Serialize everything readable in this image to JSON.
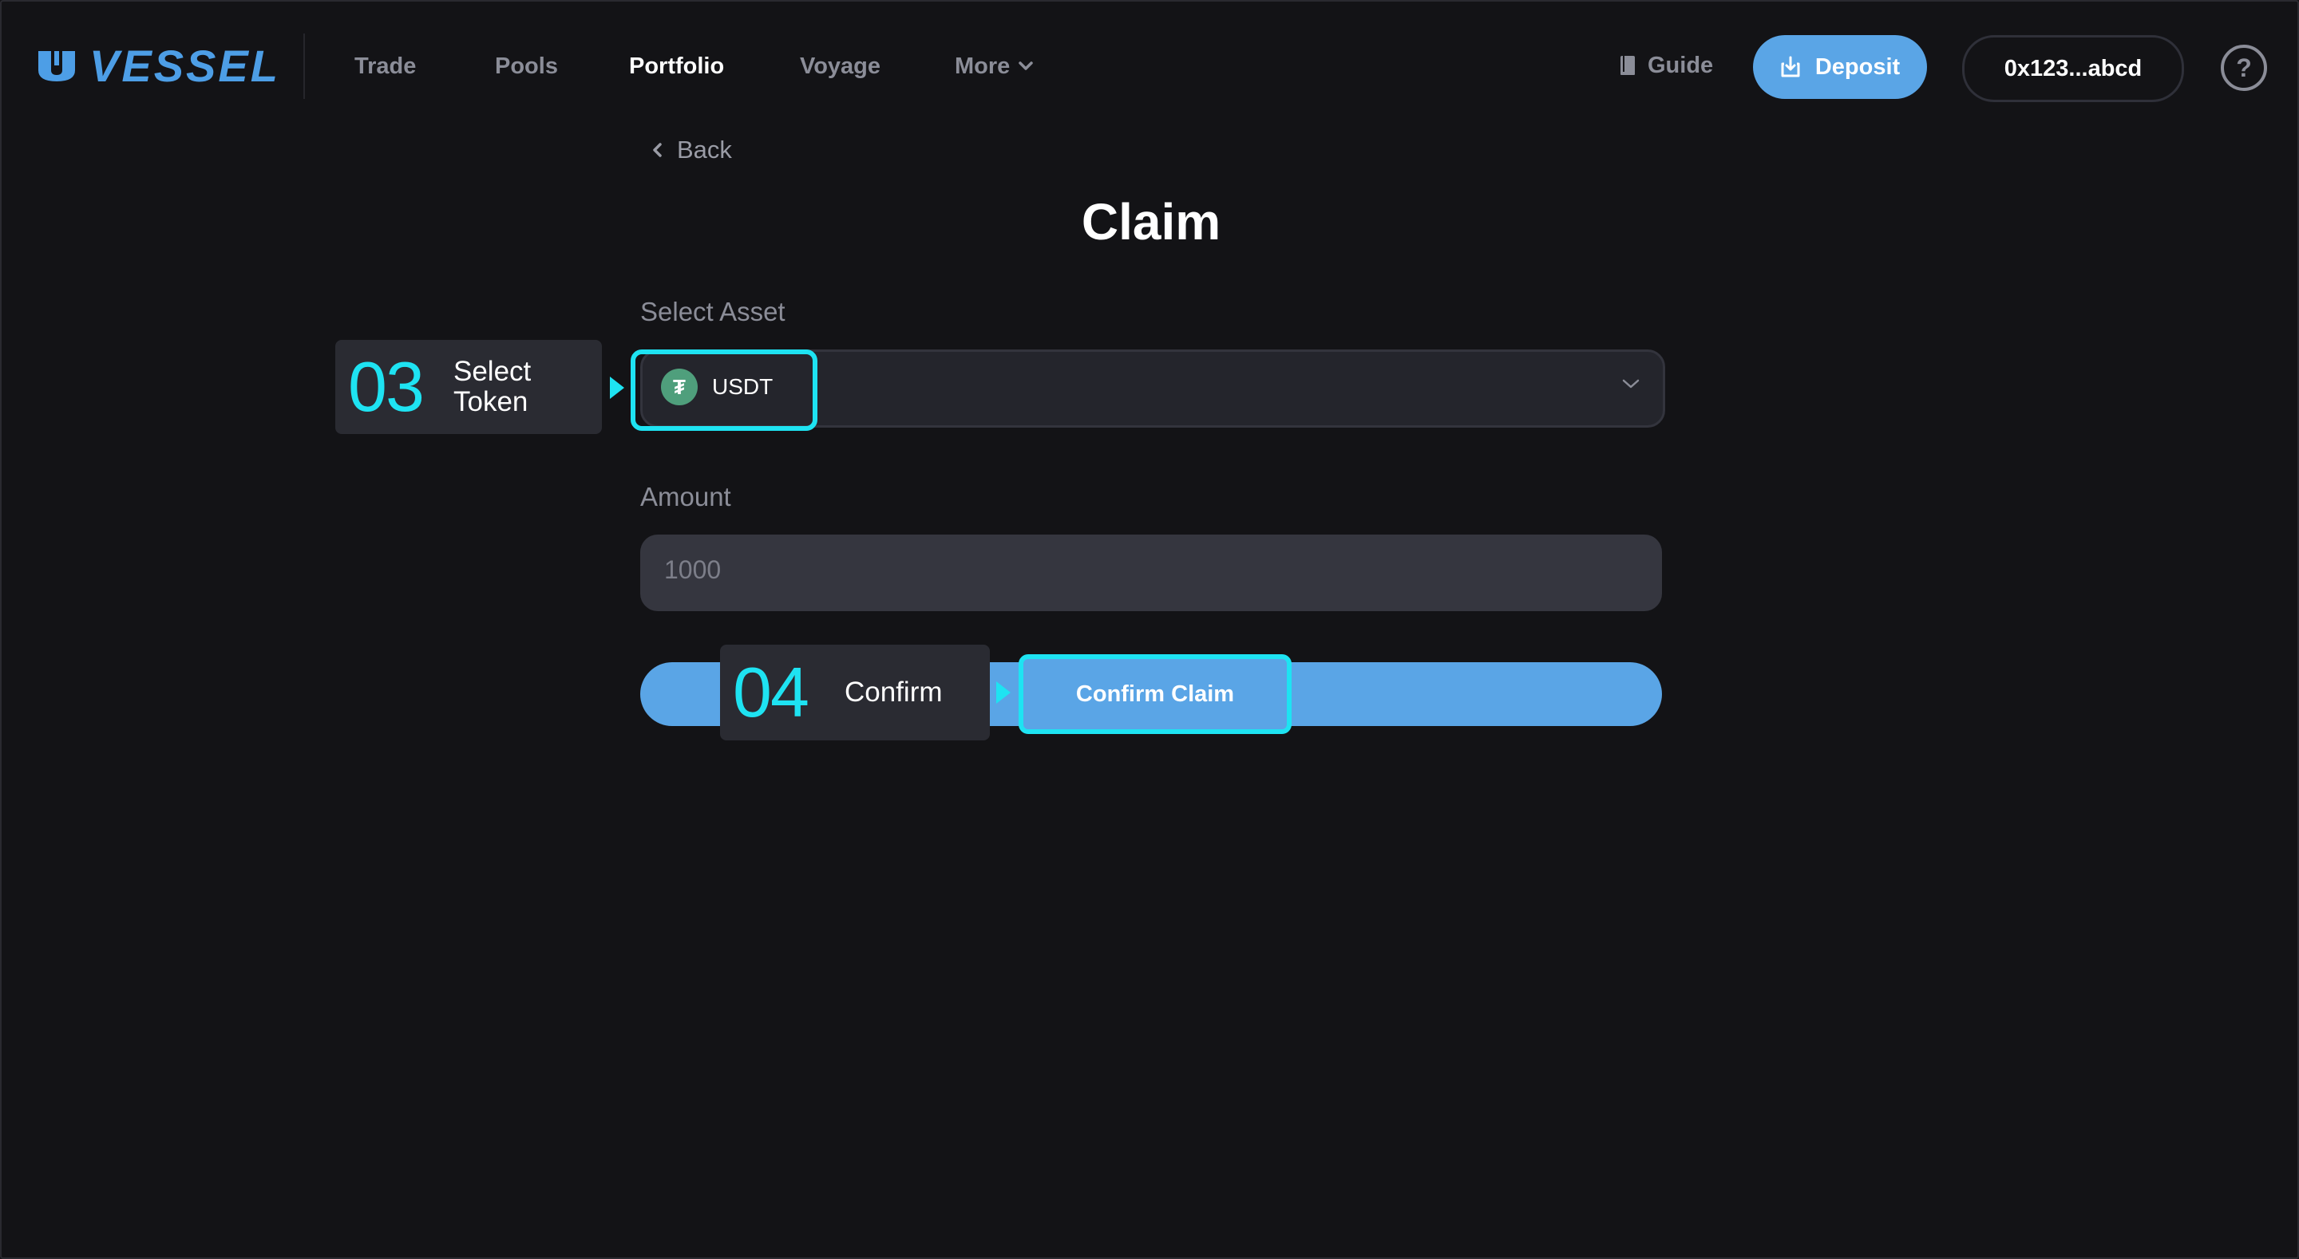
{
  "app": {
    "logo_text": "VESSEL",
    "accent_color": "#5aa5e6",
    "highlight_color": "#1ee3f2"
  },
  "nav": {
    "items": [
      {
        "label": "Trade"
      },
      {
        "label": "Pools"
      },
      {
        "label": "Portfolio",
        "active": true
      },
      {
        "label": "Voyage"
      },
      {
        "label": "More"
      }
    ]
  },
  "header": {
    "guide_label": "Guide",
    "deposit_label": "Deposit",
    "wallet_label": "0x123...abcd",
    "help_label": "?"
  },
  "main": {
    "back_label": "Back",
    "title": "Claim",
    "select_asset_label": "Select Asset",
    "selected_token": "USDT",
    "token_icon_glyph": "₮",
    "amount_label": "Amount",
    "amount_value": "",
    "amount_placeholder": "1000",
    "confirm_label": "Confirm Claim"
  },
  "callouts": [
    {
      "number": "03",
      "line1": "Select",
      "line2": "Token"
    },
    {
      "number": "04",
      "line1": "Confirm"
    }
  ]
}
